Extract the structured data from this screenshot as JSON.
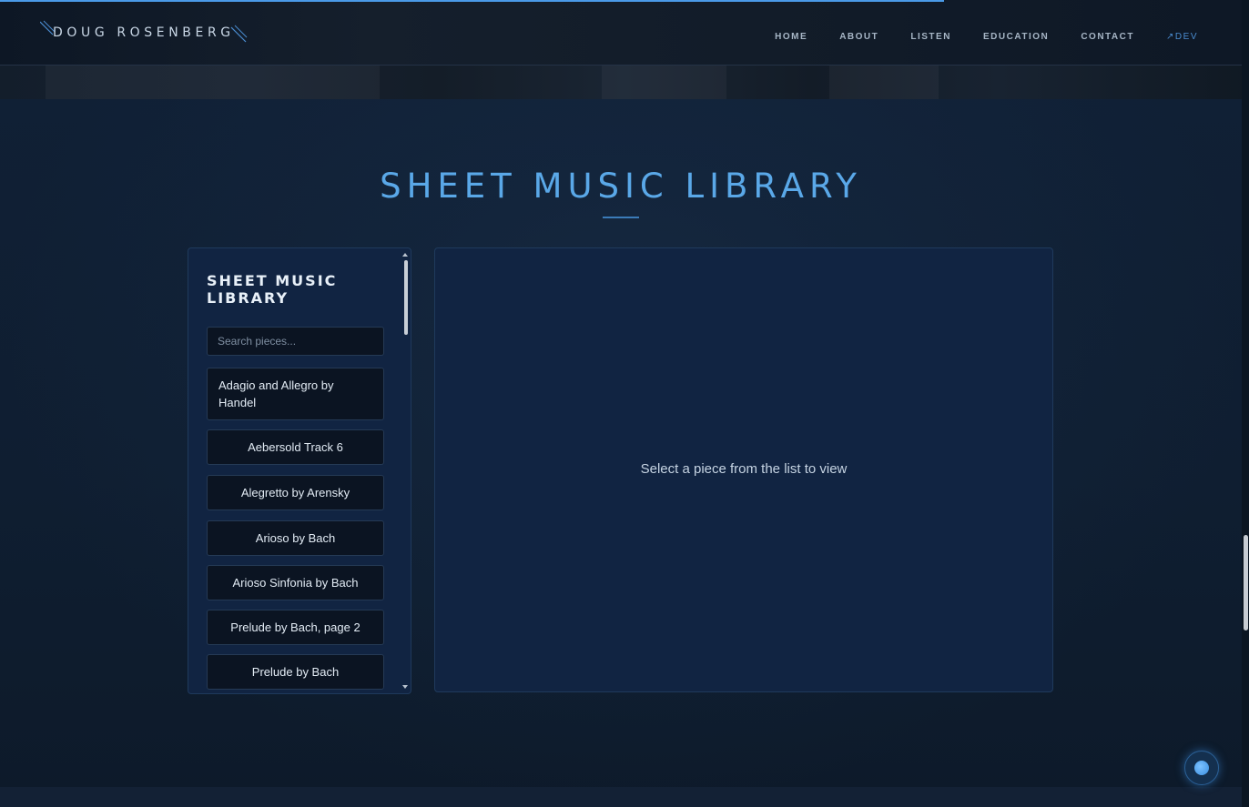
{
  "header": {
    "logo_text": "DOUG ROSENBERG",
    "nav": [
      {
        "label": "HOME"
      },
      {
        "label": "ABOUT"
      },
      {
        "label": "LISTEN"
      },
      {
        "label": "EDUCATION"
      },
      {
        "label": "CONTACT"
      },
      {
        "label": "↗DEV"
      }
    ]
  },
  "page_progress": 0.76,
  "main": {
    "title": "SHEET MUSIC LIBRARY"
  },
  "sidebar": {
    "title": "SHEET MUSIC LIBRARY",
    "search_placeholder": "Search pieces...",
    "pieces": [
      {
        "label": "Adagio and Allegro by Handel"
      },
      {
        "label": "Aebersold Track 6"
      },
      {
        "label": "Alegretto by Arensky"
      },
      {
        "label": "Arioso by Bach"
      },
      {
        "label": "Arioso Sinfonia by Bach"
      },
      {
        "label": "Prelude by Bach, page 2"
      },
      {
        "label": "Prelude by Bach"
      }
    ]
  },
  "viewer": {
    "empty_message": "Select a piece from the list to view"
  },
  "colors": {
    "accent": "#5aa8e8",
    "panel": "#112442",
    "background": "#0e1b2c"
  }
}
